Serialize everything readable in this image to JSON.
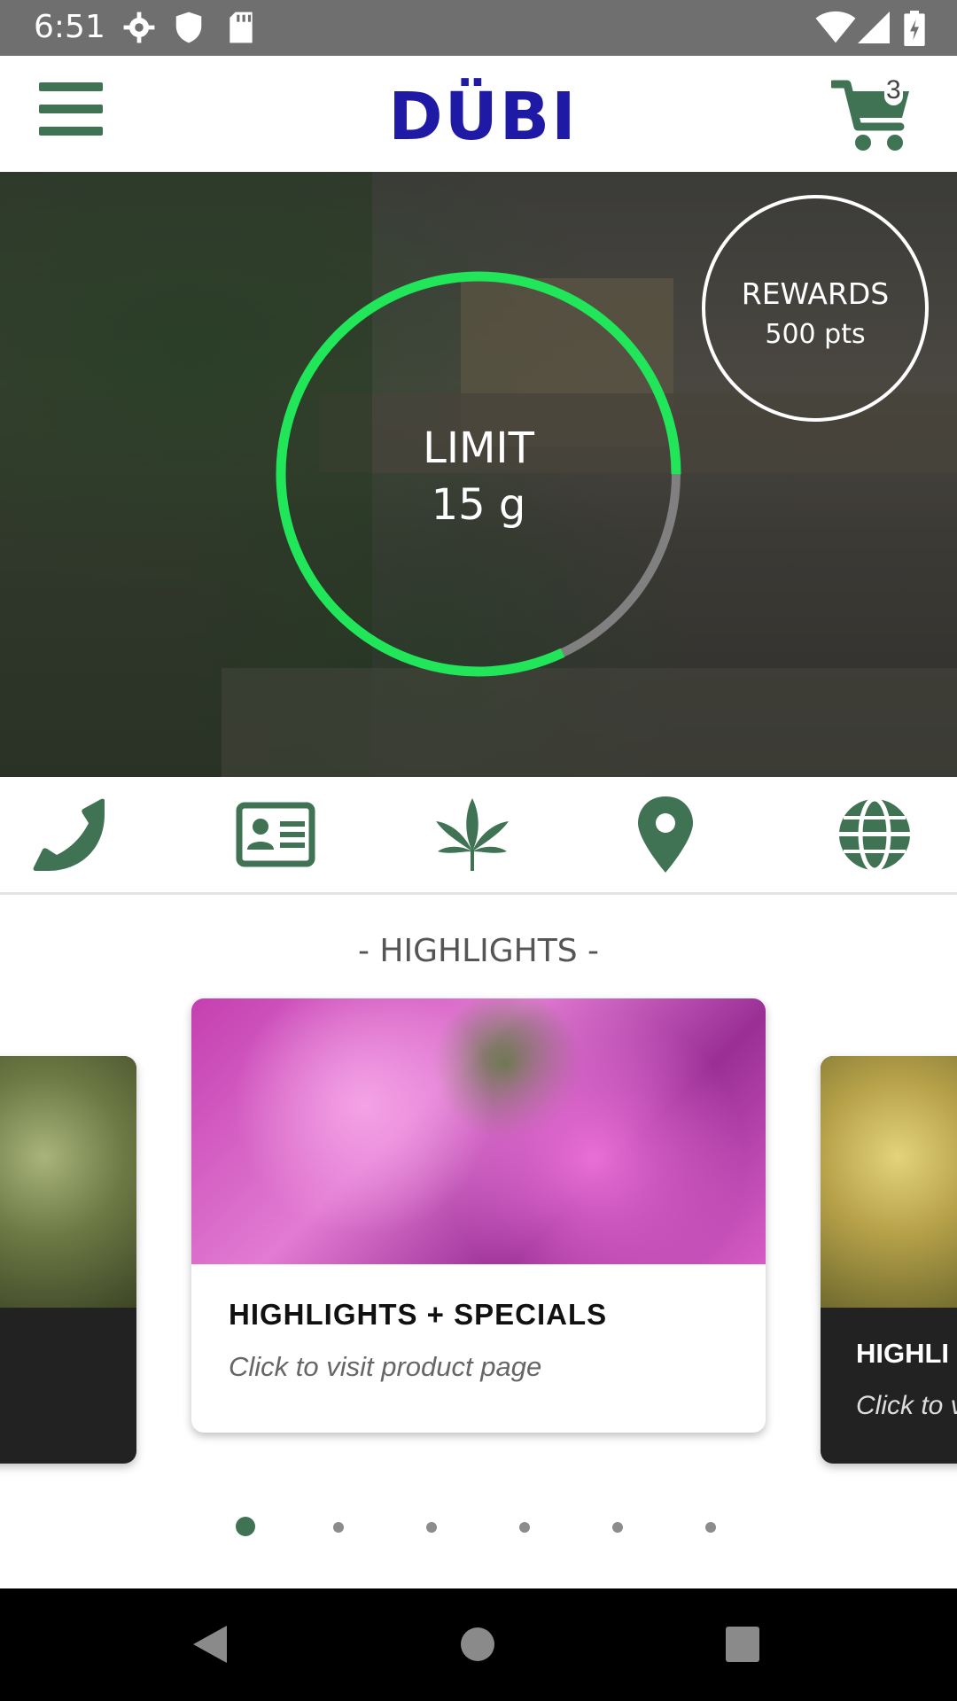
{
  "status_bar": {
    "time": "6:51"
  },
  "app_bar": {
    "logo_text": "DÜBI",
    "cart_count": "3"
  },
  "hero": {
    "limit_label": "LIMIT",
    "limit_value": "15 g",
    "limit_progress": 0.82,
    "rewards_label": "REWARDS",
    "rewards_points": "500 pts"
  },
  "quick_actions": [
    {
      "icon": "phone-icon"
    },
    {
      "icon": "id-card-icon"
    },
    {
      "icon": "cannabis-leaf-icon"
    },
    {
      "icon": "map-pin-icon"
    },
    {
      "icon": "globe-icon"
    }
  ],
  "highlights": {
    "title": "- HIGHLIGHTS -",
    "cards": [
      {
        "title": "HIGHLIGHTS + SPECIALS",
        "subtitle": "Click to visit product page"
      },
      {
        "title": "HIGHLI",
        "subtitle": "Click to v"
      }
    ],
    "page_count": 6,
    "active_page": 0
  },
  "colors": {
    "accent": "#3f7354",
    "logo": "#1e1aa6",
    "logo_dots": "#e0116e",
    "ring_progress": "#21e65a",
    "ring_track": "#808080"
  }
}
